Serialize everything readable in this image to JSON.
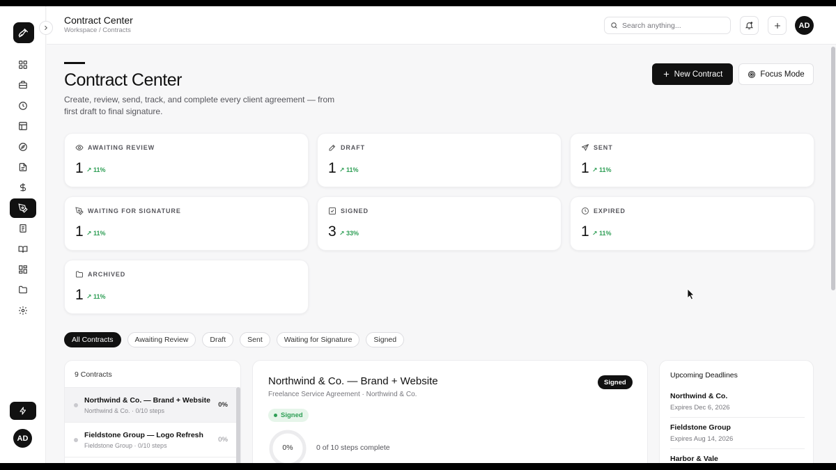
{
  "header": {
    "title": "Contract Center",
    "breadcrumb": "Workspace / Contracts",
    "search_placeholder": "Search anything...",
    "avatar_initials": "AD"
  },
  "sidebar": {
    "avatar_initials": "AD",
    "icons": [
      "grid-icon",
      "briefcase-icon",
      "clock-icon",
      "layout-icon",
      "compass-icon",
      "file-text-icon",
      "dollar-icon",
      "pen-tool-icon",
      "receipt-icon",
      "book-open-icon",
      "apps-icon",
      "folder-icon",
      "settings-icon"
    ],
    "active_index": 7
  },
  "page": {
    "title": "Contract Center",
    "subtitle": "Create, review, send, track, and complete every client agreement — from first draft to final signature.",
    "new_contract_label": "New Contract",
    "focus_mode_label": "Focus Mode"
  },
  "stats": [
    {
      "label": "AWAITING REVIEW",
      "value": "1",
      "delta": "11%",
      "icon": "eye-icon"
    },
    {
      "label": "DRAFT",
      "value": "1",
      "delta": "11%",
      "icon": "pencil-icon"
    },
    {
      "label": "SENT",
      "value": "1",
      "delta": "11%",
      "icon": "send-icon"
    },
    {
      "label": "WAITING FOR SIGNATURE",
      "value": "1",
      "delta": "11%",
      "icon": "pen-tool-icon"
    },
    {
      "label": "SIGNED",
      "value": "3",
      "delta": "33%",
      "icon": "check-square-icon"
    },
    {
      "label": "EXPIRED",
      "value": "1",
      "delta": "11%",
      "icon": "clock-icon"
    },
    {
      "label": "ARCHIVED",
      "value": "1",
      "delta": "11%",
      "icon": "folder-icon"
    }
  ],
  "filters": [
    "All Contracts",
    "Awaiting Review",
    "Draft",
    "Sent",
    "Waiting for Signature",
    "Signed"
  ],
  "contracts_list": {
    "count_label": "9 Contracts",
    "items": [
      {
        "title": "Northwind & Co. — Brand + Website",
        "meta": "Northwind & Co. · 0/10 steps",
        "progress": "0%"
      },
      {
        "title": "Fieldstone Group — Logo Refresh",
        "meta": "Fieldstone Group · 0/10 steps",
        "progress": "0%"
      }
    ]
  },
  "detail": {
    "title": "Northwind & Co. — Brand + Website",
    "subtitle": "Freelance Service Agreement · Northwind & Co.",
    "badge": "Signed",
    "status": "Signed",
    "progress_label": "0%",
    "progress_fraction": 0,
    "steps_text": "0 of 10 steps complete"
  },
  "deadlines": {
    "title": "Upcoming Deadlines",
    "items": [
      {
        "name": "Northwind & Co.",
        "date": "Expires Dec 6, 2026"
      },
      {
        "name": "Fieldstone Group",
        "date": "Expires Aug 14, 2026"
      },
      {
        "name": "Harbor & Vale",
        "date": ""
      }
    ]
  },
  "colors": {
    "accent": "#111111",
    "positive": "#2e9e55",
    "background": "#f7f7f8"
  }
}
